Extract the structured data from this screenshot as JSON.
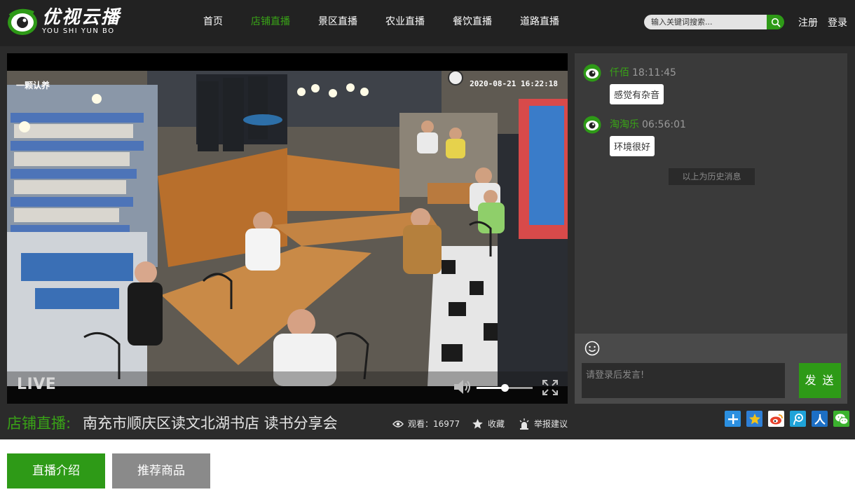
{
  "brand": {
    "name": "优视云播",
    "subtitle": "YOU SHI YUN BO",
    "logo_icon": "eye-logo-icon",
    "accent_color": "#39a317"
  },
  "nav": {
    "items": [
      {
        "label": "首页",
        "active": false
      },
      {
        "label": "店铺直播",
        "active": true
      },
      {
        "label": "景区直播",
        "active": false
      },
      {
        "label": "农业直播",
        "active": false
      },
      {
        "label": "餐饮直播",
        "active": false
      },
      {
        "label": "道路直播",
        "active": false
      }
    ]
  },
  "search": {
    "placeholder": "输入关键词搜索...",
    "value": "",
    "icon": "search-icon"
  },
  "auth": {
    "register": "注册",
    "login": "登录"
  },
  "player": {
    "overlay_name": "一颗认养",
    "overlay_timestamp": "2020-08-21  16:22:18",
    "live_label": "LIVE",
    "volume_level": 0.5,
    "volume_icon": "speaker-icon",
    "fullscreen_icon": "fullscreen-icon"
  },
  "chat": {
    "messages": [
      {
        "user": "仟佰",
        "time": "18:11:45",
        "text": "感觉有杂音",
        "avatar_icon": "eye-avatar-icon"
      },
      {
        "user": "淘淘乐",
        "time": "06:56:01",
        "text": "环境很好",
        "avatar_icon": "eye-avatar-icon"
      }
    ],
    "history_note": "以上为历史消息",
    "emoji_icon": "smiley-icon",
    "input_placeholder": "请登录后发言!",
    "send_label": "发 送"
  },
  "stream": {
    "category": "店铺直播:",
    "title": "南充市顺庆区读文北湖书店 读书分享会",
    "views_label": "观看：16977",
    "favorite_label": "收藏",
    "report_label": "举报建议"
  },
  "share": [
    {
      "icon": "plus-share-icon",
      "color": "#2b8fe0"
    },
    {
      "icon": "qzone-star-icon",
      "color": "#2e7fd6"
    },
    {
      "icon": "weibo-icon",
      "color": "#e8412c"
    },
    {
      "icon": "tencent-weibo-icon",
      "color": "#1fa3d8"
    },
    {
      "icon": "renren-icon",
      "color": "#1d6fc4"
    },
    {
      "icon": "wechat-icon",
      "color": "#3bb22f"
    }
  ],
  "tabs": [
    {
      "label": "直播介绍",
      "active": true,
      "color": "#2e9a17"
    },
    {
      "label": "推荐商品",
      "active": false,
      "color": "#8a8a8a"
    }
  ]
}
